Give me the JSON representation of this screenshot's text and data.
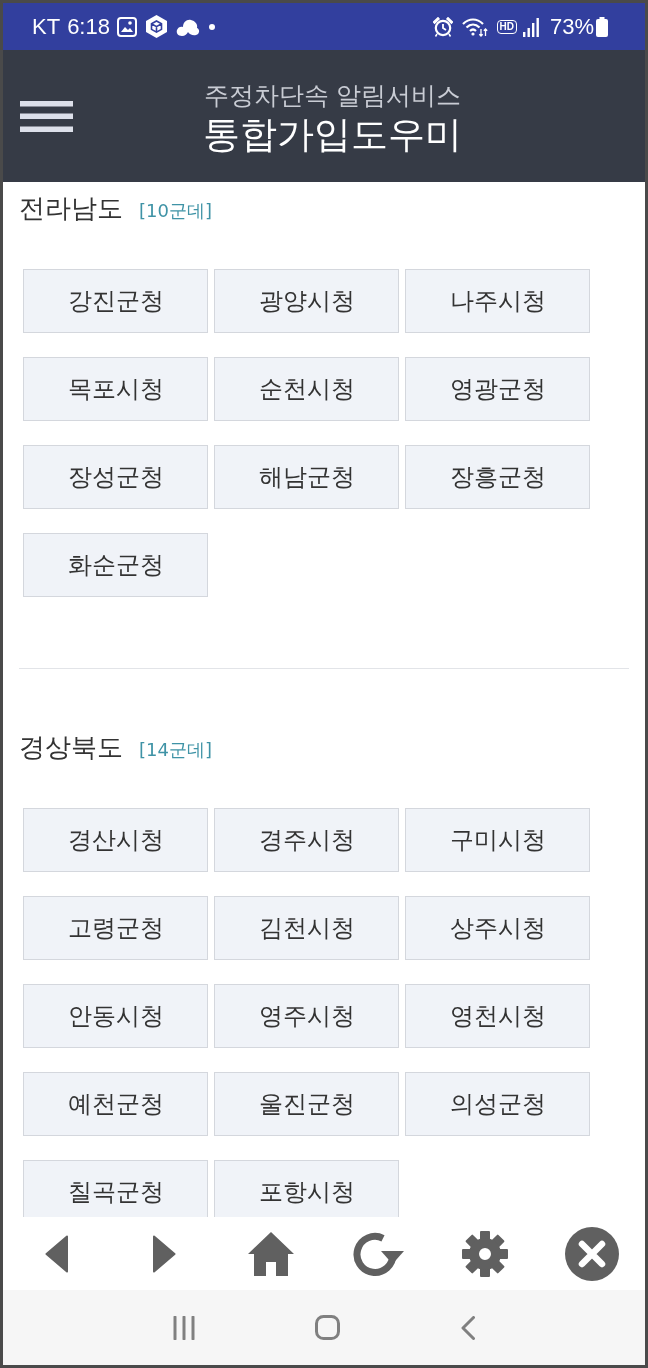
{
  "status_bar": {
    "carrier": "KT",
    "time": "6:18",
    "hd_label": "HD",
    "battery": "73%"
  },
  "header": {
    "subtitle": "주정차단속 알림서비스",
    "title": "통합가입도우미"
  },
  "sections": [
    {
      "name": "전라남도",
      "count": "[10군데]",
      "items": [
        "강진군청",
        "광양시청",
        "나주시청",
        "목포시청",
        "순천시청",
        "영광군청",
        "장성군청",
        "해남군청",
        "장흥군청",
        "화순군청"
      ]
    },
    {
      "name": "경상북도",
      "count": "[14군데]",
      "items": [
        "경산시청",
        "경주시청",
        "구미시청",
        "고령군청",
        "김천시청",
        "상주시청",
        "안동시청",
        "영주시청",
        "영천시청",
        "예천군청",
        "울진군청",
        "의성군청",
        "칠곡군청",
        "포항시청"
      ]
    }
  ]
}
